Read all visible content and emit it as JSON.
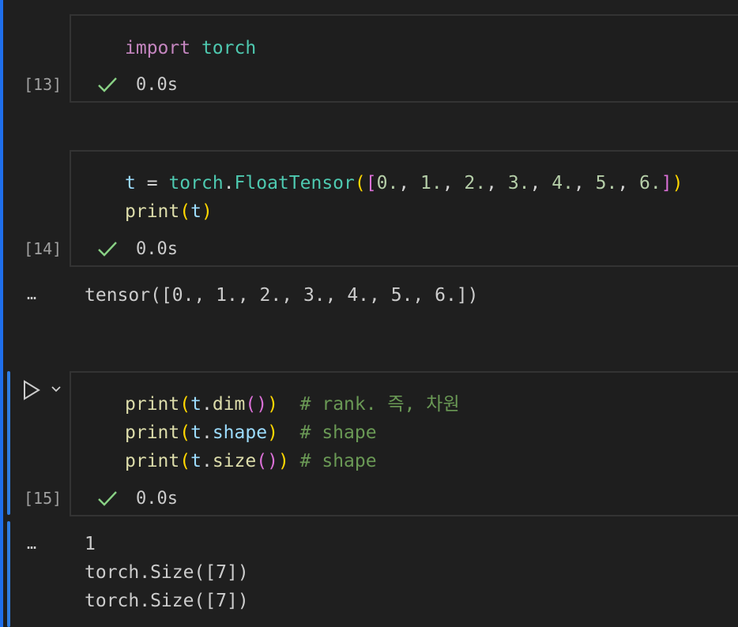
{
  "cells": [
    {
      "exec_count": "[13]",
      "status_time": "0.0s",
      "code": {
        "line1": {
          "kw": "import",
          "mod": "torch"
        }
      }
    },
    {
      "exec_count": "[14]",
      "status_time": "0.0s",
      "code": {
        "line1": {
          "var": "t",
          "op": "=",
          "mod": "torch",
          "dot": ".",
          "fn": "FloatTensor",
          "open_paren": "(",
          "open_bracket": "[",
          "nums": [
            "0.",
            "1.",
            "2.",
            "3.",
            "4.",
            "5.",
            "6."
          ],
          "sep": ", ",
          "close_bracket": "]",
          "close_paren": ")"
        },
        "line2": {
          "fn": "print",
          "open_paren": "(",
          "var": "t",
          "close_paren": ")"
        }
      },
      "output": {
        "ellipsis": "…",
        "lines": [
          "tensor([0., 1., 2., 3., 4., 5., 6.])"
        ]
      }
    },
    {
      "exec_count": "[15]",
      "status_time": "0.0s",
      "code": {
        "line1": {
          "fn": "print",
          "p1o": "(",
          "var": "t",
          "dot": ".",
          "method": "dim",
          "p2o": "(",
          "p2c": ")",
          "p1c": ")",
          "comment": "# rank. 즉, 차원"
        },
        "line2": {
          "fn": "print",
          "p1o": "(",
          "var": "t",
          "dot": ".",
          "attr": "shape",
          "p1c": ")",
          "comment": "# shape"
        },
        "line3": {
          "fn": "print",
          "p1o": "(",
          "var": "t",
          "dot": ".",
          "method": "size",
          "p2o": "(",
          "p2c": ")",
          "p1c": ")",
          "comment": "# shape"
        }
      },
      "output": {
        "ellipsis": "…",
        "lines": [
          "1",
          "torch.Size([7])",
          "torch.Size([7])"
        ]
      }
    }
  ],
  "icons": {
    "check": "check-icon",
    "run": "play-icon",
    "chevron": "chevron-down-icon"
  },
  "colors": {
    "accent": "#1f6feb",
    "check": "#89d185",
    "keyword": "#c586c0",
    "module": "#4ec9b0",
    "function": "#dcdcaa",
    "variable": "#9cdcfe",
    "number": "#b5cea8",
    "comment": "#6a9955"
  }
}
